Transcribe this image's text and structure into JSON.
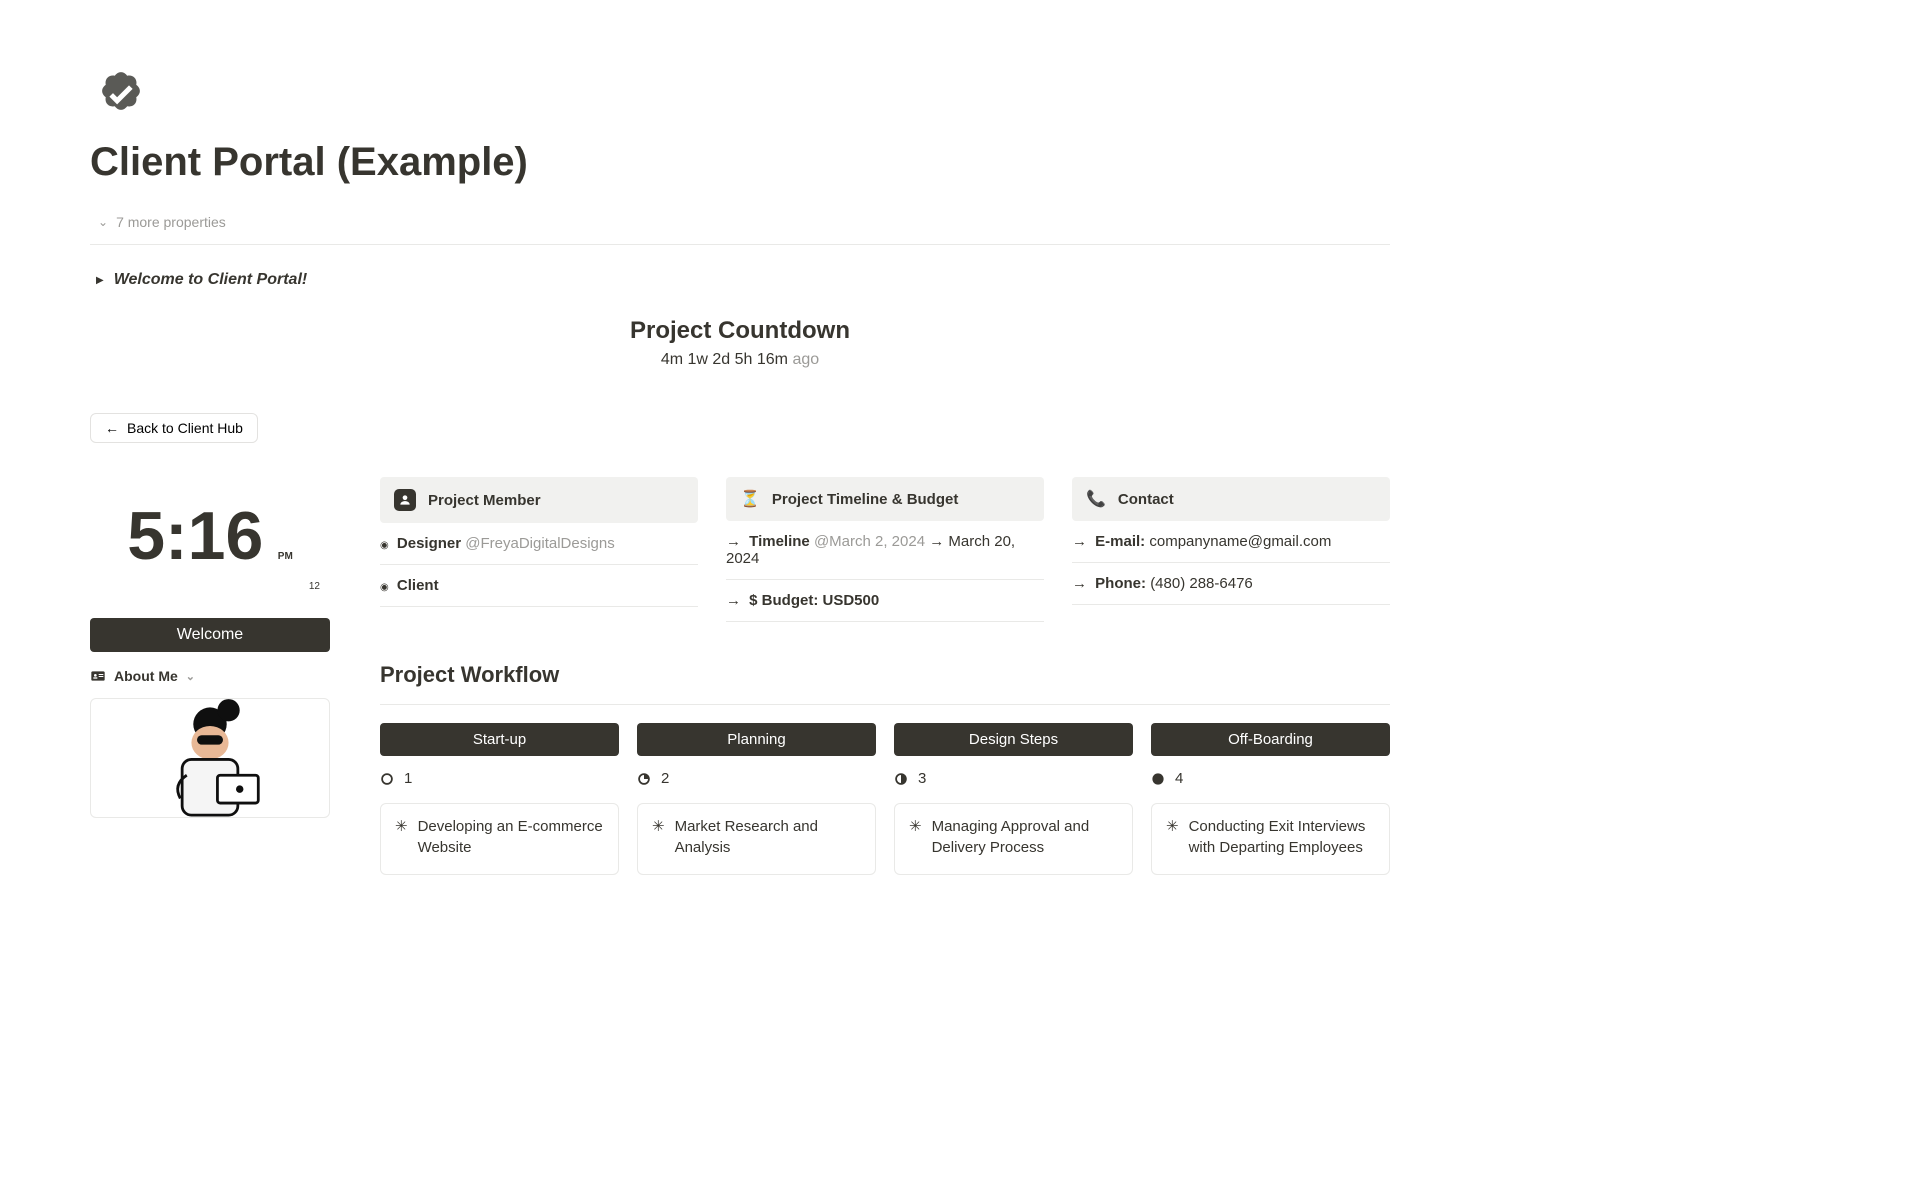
{
  "page": {
    "title": "Client Portal (Example)",
    "more_props": "7 more properties",
    "welcome_toggle": "Welcome to Client Portal!"
  },
  "countdown": {
    "title": "Project Countdown",
    "value": "4m 1w 2d 5h 16m",
    "ago": " ago"
  },
  "back_button": "Back to Client Hub",
  "clock": {
    "time": "5:16",
    "ampm": "PM",
    "seconds": "12"
  },
  "left": {
    "welcome": "Welcome",
    "about": "About Me"
  },
  "cards": {
    "member": {
      "title": "Project Member",
      "designer_label": "Designer",
      "designer_handle": "@FreyaDigitalDesigns",
      "client_label": "Client"
    },
    "timeline": {
      "title": "Project Timeline & Budget",
      "timeline_label": "Timeline",
      "timeline_at": "@March 2, 2024",
      "timeline_end": "March 20, 2024",
      "budget": "$ Budget: USD500"
    },
    "contact": {
      "title": "Contact",
      "email_label": "E-mail:",
      "email": "companyname@gmail.com",
      "phone_label": "Phone:",
      "phone": "(480) 288-6476"
    }
  },
  "workflow": {
    "title": "Project Workflow",
    "cols": [
      {
        "name": "Start-up",
        "num": "1",
        "card": "Developing an E-commerce Website"
      },
      {
        "name": "Planning",
        "num": "2",
        "card": "Market Research and Analysis"
      },
      {
        "name": "Design Steps",
        "num": "3",
        "card": "Managing Approval and Delivery Process"
      },
      {
        "name": "Off-Boarding",
        "num": "4",
        "card": "Conducting Exit Interviews with Departing Employees"
      }
    ]
  }
}
